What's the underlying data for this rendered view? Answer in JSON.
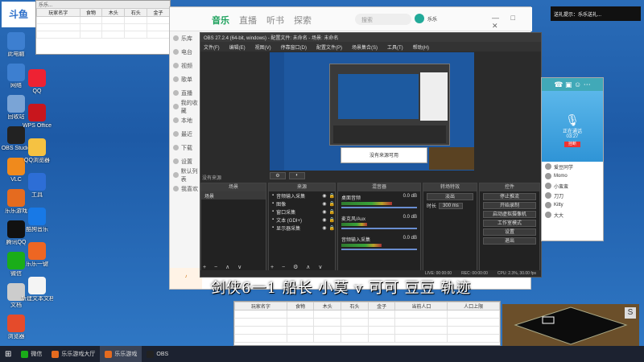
{
  "notification": "送礼提示：乐乐送礼...",
  "top_left_window": {
    "title": "乐乐...",
    "columns": [
      "玩家名字",
      "食物",
      "木头",
      "石头",
      "金子"
    ]
  },
  "desktop_icons": [
    {
      "label": "此电脑",
      "icon": "computer-icon",
      "color": "#3d7fd0"
    },
    {
      "label": "网络",
      "icon": "network-icon",
      "color": "#3d7fd0"
    },
    {
      "label": "回收站",
      "icon": "recycle-bin-icon",
      "color": "#7aa4d6"
    },
    {
      "label": "OBS Studio",
      "icon": "obs-icon",
      "color": "#222"
    },
    {
      "label": "VLC",
      "icon": "vlc-icon",
      "color": "#f08a1c"
    },
    {
      "label": "乐乐游戏",
      "icon": "game-icon",
      "color": "#e56b1f"
    },
    {
      "label": "腾讯QQ",
      "icon": "qq-icon",
      "color": "#111"
    },
    {
      "label": "微信",
      "icon": "wechat-icon",
      "color": "#1aad19"
    },
    {
      "label": "文档",
      "icon": "document-icon",
      "color": "#ccc"
    },
    {
      "label": "浏览器",
      "icon": "browser-icon",
      "color": "#e54b2b"
    }
  ],
  "desktop_icons_col2": [
    {
      "label": "QQ",
      "icon": "qq-icon",
      "color": "#e23"
    },
    {
      "label": "WPS Office",
      "icon": "wps-icon",
      "color": "#c8161d"
    },
    {
      "label": "QQ浏览器",
      "icon": "browser-icon",
      "color": "#f5c242"
    },
    {
      "label": "工具",
      "icon": "tools-icon",
      "color": "#2d6ed6"
    },
    {
      "label": "酷狗音乐",
      "icon": "kugou-icon",
      "color": "#1879e6"
    },
    {
      "label": "乐乐一键",
      "icon": "rocket-icon",
      "color": "#e62"
    },
    {
      "label": "新建文本文档",
      "icon": "text-file-icon",
      "color": "#f4f4f4"
    }
  ],
  "music_app": {
    "tabs": [
      "音乐",
      "直播",
      "听书",
      "探索"
    ],
    "search_placeholder": "搜索",
    "user": "乐乐",
    "side_items": [
      "乐库",
      "电台",
      "视频",
      "歌单",
      "直播",
      "我的收藏",
      "本地",
      "最近",
      "下载",
      "设置",
      "默认列表",
      "我喜欢"
    ]
  },
  "obs": {
    "title": "OBS 27.2.4 (64-bit, windows) - 配置文件: 未命名 - 场景: 未命名",
    "menu": [
      "文件(F)",
      "编辑(E)",
      "视图(V)",
      "停靠窗口(D)",
      "配置文件(P)",
      "场景集合(S)",
      "工具(T)",
      "帮助(H)"
    ],
    "scenes_header": "场景",
    "scene": "场景",
    "sources_header": "来源",
    "sources": [
      "音频输入采集",
      "图像",
      "窗口采集",
      "文本 (GDI+)",
      "显示器采集"
    ],
    "mixer_header": "混音器",
    "mixer_tracks": [
      {
        "name": "桌面音频",
        "db": "0.0 dB",
        "level": 0.7
      },
      {
        "name": "麦克风/Aux",
        "db": "0.0 dB",
        "level": 0.35
      },
      {
        "name": "音频输入采集",
        "db": "0.0 dB",
        "level": 0.55
      }
    ],
    "transitions_header": "转场特效",
    "transition": "淡出",
    "duration_label": "时长",
    "duration": "300 ms",
    "controls_header": "控件",
    "controls": [
      "停止推流",
      "开始录制",
      "启动虚拟摄像机",
      "工作室模式",
      "设置",
      "退出"
    ],
    "status": [
      "LIVE: 00:00:00",
      "REC: 00:00:00",
      "CPU: 2.3%, 30.00 fps"
    ],
    "no_source_tip": "没有来源",
    "preview_hint": "没有来源可用"
  },
  "chat": {
    "call_title": "正在通话",
    "call_time": "03:27",
    "hangup": "挂断",
    "users": [
      "爱豆同学",
      "Momo",
      "小蛮蛮",
      "刀刀",
      "Kitty",
      "大大"
    ]
  },
  "overlay_text": "剑侠6一1 船长 小莫 v 可可 豆豆 轨迹",
  "game_table_columns": [
    "玩家名字",
    "食物",
    "木头",
    "石头",
    "金子",
    "当前人口",
    "人口上限"
  ],
  "minimap_label": "S",
  "taskbar": [
    {
      "label": "微信",
      "icon": "wechat-icon",
      "color": "#1aad19"
    },
    {
      "label": "乐乐游戏大厅",
      "icon": "game-icon",
      "color": "#e56b1f"
    },
    {
      "label": "乐乐游戏",
      "icon": "game-icon",
      "color": "#e56b1f"
    },
    {
      "label": "OBS",
      "icon": "obs-icon",
      "color": "#222"
    }
  ]
}
